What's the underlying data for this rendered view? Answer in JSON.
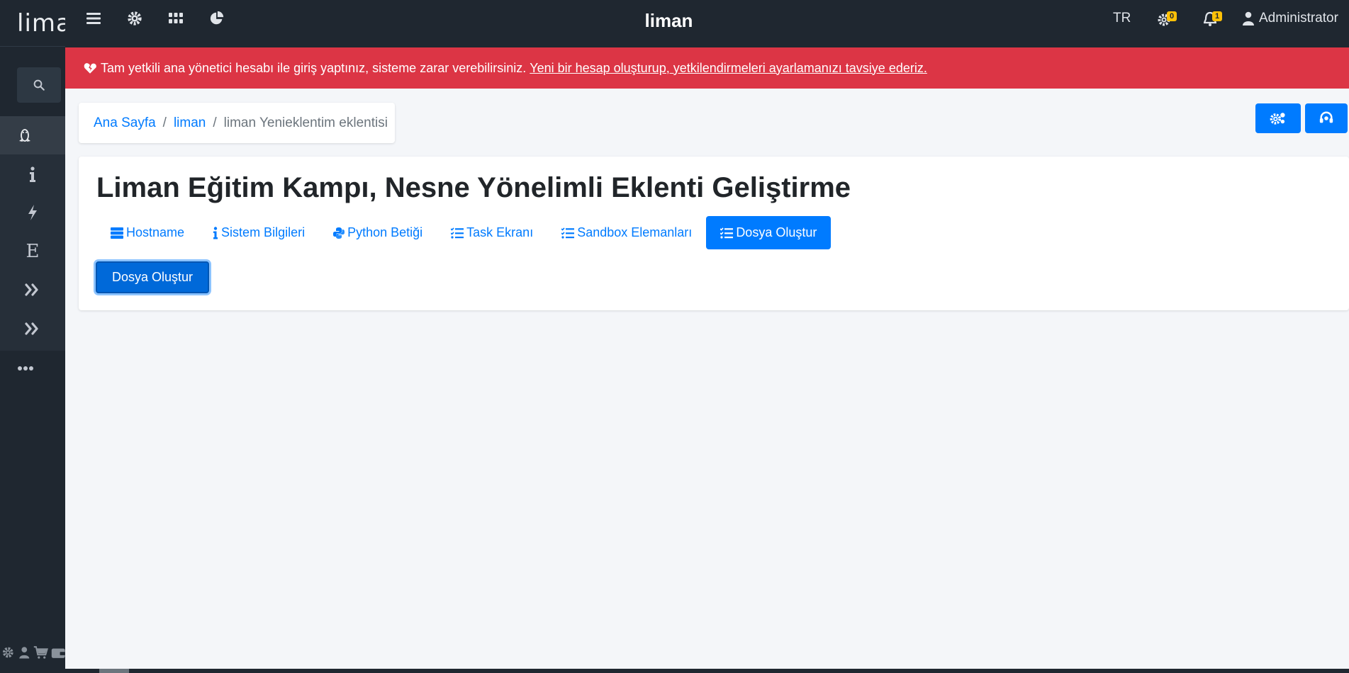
{
  "sidebar": {
    "brand": "lima",
    "items": [
      {
        "icon": "linux-icon",
        "active": true
      },
      {
        "icon": "info-icon"
      },
      {
        "icon": "bolt-icon"
      },
      {
        "icon": "letter-e-icon",
        "glyph": "E"
      },
      {
        "icon": "double-chevron-right-icon"
      },
      {
        "icon": "double-chevron-right-icon"
      },
      {
        "icon": "ellipsis-icon"
      }
    ],
    "bottom_icons": [
      "gear-icon",
      "user-icon",
      "cart-icon",
      "wallet-icon"
    ]
  },
  "navbar": {
    "title": "liman",
    "language": "TR",
    "settings_badge": "0",
    "notifications_badge": "1",
    "user": "Administrator"
  },
  "alert": {
    "message": "Tam yetkili ana yönetici hesabı ile giriş yaptınız, sisteme zarar verebilirsiniz.",
    "link": "Yeni bir hesap oluşturup, yetkilendirmeleri ayarlamanızı tavsiye ederiz."
  },
  "breadcrumb": {
    "home": "Ana Sayfa",
    "server": "liman",
    "current": "liman Yenieklentim eklentisi"
  },
  "card": {
    "title": "Liman Eğitim Kampı, Nesne Yönelimli Eklenti Geliştirme",
    "tabs": [
      {
        "label": "Hostname",
        "icon": "server-icon"
      },
      {
        "label": "Sistem Bilgileri",
        "icon": "info-icon"
      },
      {
        "label": "Python Betiği",
        "icon": "python-icon"
      },
      {
        "label": "Task Ekranı",
        "icon": "tasks-icon"
      },
      {
        "label": "Sandbox Elemanları",
        "icon": "tasks-icon"
      },
      {
        "label": "Dosya Oluştur",
        "icon": "tasks-icon",
        "active": true
      }
    ],
    "action_button": "Dosya Oluştur"
  },
  "colors": {
    "primary": "#007bff",
    "danger": "#dc3545",
    "dark": "#1f2730",
    "warning": "#ffc107"
  }
}
